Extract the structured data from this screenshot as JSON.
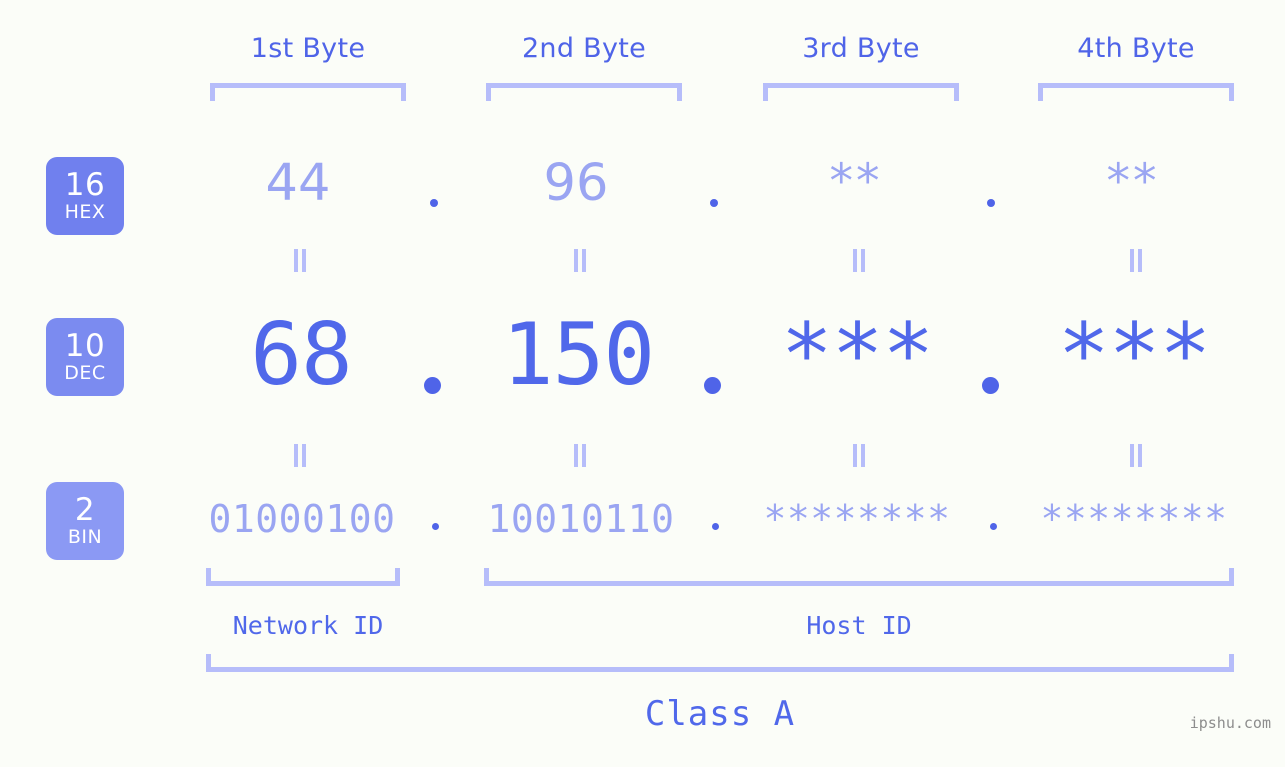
{
  "page": {
    "background_color": "#fbfdf8",
    "accent_color": "#5068ea",
    "accent_light_color": "#9aa5f2",
    "bracket_color": "#b6bdfa",
    "watermark": "ipshu.com"
  },
  "header": {
    "bytes": [
      {
        "label": "1st Byte"
      },
      {
        "label": "2nd Byte"
      },
      {
        "label": "3rd Byte"
      },
      {
        "label": "4th Byte"
      }
    ]
  },
  "bases": [
    {
      "number": "16",
      "name": "HEX"
    },
    {
      "number": "10",
      "name": "DEC"
    },
    {
      "number": "2",
      "name": "BIN"
    }
  ],
  "rows": {
    "hex": {
      "base_number": "16",
      "base_name": "HEX",
      "values": [
        "44",
        "96",
        "**",
        "**"
      ]
    },
    "dec": {
      "base_number": "10",
      "base_name": "DEC",
      "values": [
        "68",
        "150",
        "***",
        "***"
      ]
    },
    "bin": {
      "base_number": "2",
      "base_name": "BIN",
      "values": [
        "01000100",
        "10010110",
        "********",
        "********"
      ]
    }
  },
  "separators": {
    "dot": "."
  },
  "equals_marks": {
    "symbol": "="
  },
  "footer": {
    "network_id_label": "Network ID",
    "host_id_label": "Host ID",
    "class_label": "Class A"
  }
}
